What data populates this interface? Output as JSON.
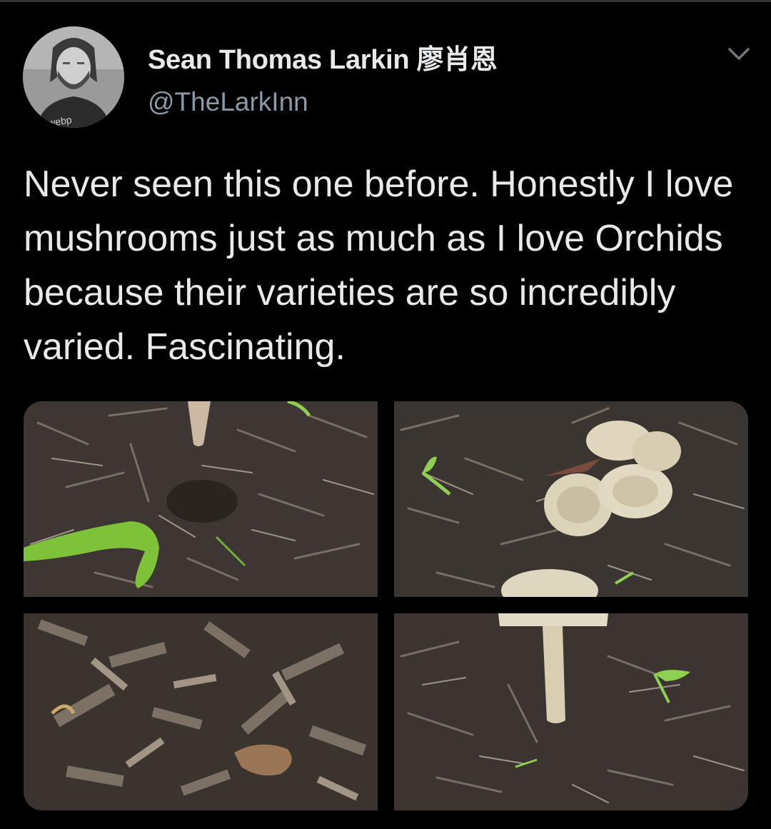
{
  "tweet": {
    "author": {
      "display_name": "Sean Thomas Larkin 廖肖恩",
      "handle": "@TheLarkInn",
      "avatar_icon": "avatar-photo"
    },
    "menu_icon": "chevron-down-icon",
    "text": "Never seen this one before. Honestly I love mushrooms just as much as I love Orchids because their varieties are so incredibly varied. Fascinating.",
    "media": [
      {
        "description_icon": "photo-mulch-seed"
      },
      {
        "description_icon": "photo-mushroom-caps"
      },
      {
        "description_icon": "photo-mulch"
      },
      {
        "description_icon": "photo-mushroom-stem"
      }
    ]
  },
  "colors": {
    "background": "#000000",
    "text_primary": "#e7e9ea",
    "text_secondary": "#8b98a5"
  }
}
